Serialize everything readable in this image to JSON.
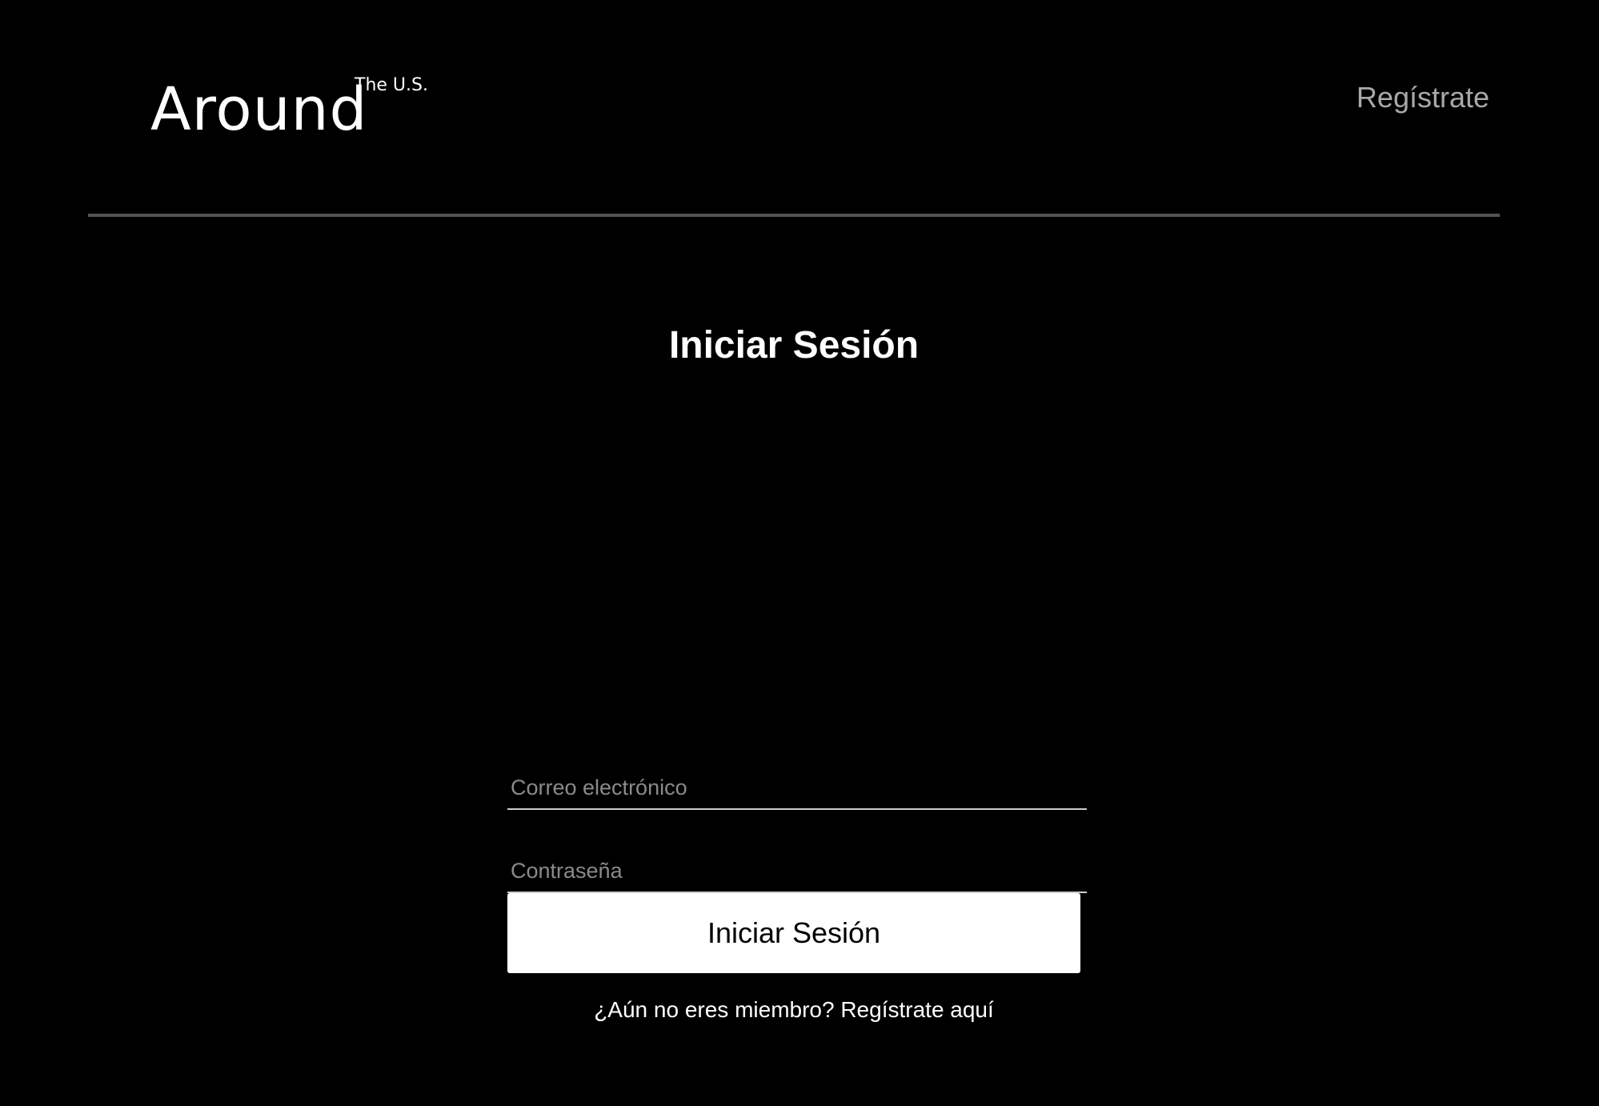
{
  "header": {
    "logo": {
      "main": "Around",
      "superscript": "The U.S."
    },
    "register_link": "Regístrate"
  },
  "login_form": {
    "title": "Iniciar Sesión",
    "email": {
      "placeholder": "Correo electrónico",
      "value": ""
    },
    "password": {
      "placeholder": "Contraseña",
      "value": ""
    },
    "submit_label": "Iniciar Sesión",
    "signup_prompt": "¿Aún no eres miembro? Regístrate aquí"
  },
  "colors": {
    "background": "#000000",
    "text": "#ffffff",
    "muted_link": "#a9a9a9",
    "placeholder": "#8a8a8a",
    "divider": "#545454",
    "button_background": "#ffffff",
    "button_text": "#000000"
  }
}
